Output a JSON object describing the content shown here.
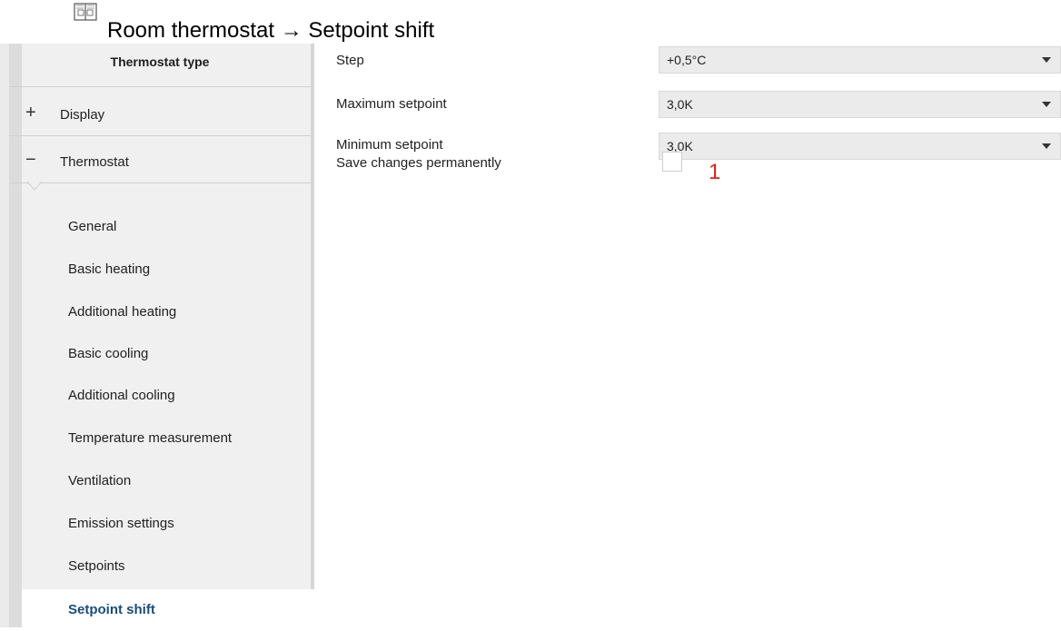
{
  "header": {
    "title": "Room thermostat → Setpoint shift",
    "icon": "book-icon"
  },
  "sidebar": {
    "section_title": "Thermostat type",
    "display": {
      "sign": "+",
      "label": "Display"
    },
    "thermostat": {
      "sign": "−",
      "label": "Thermostat"
    },
    "items": [
      {
        "label": "General"
      },
      {
        "label": "Basic heating"
      },
      {
        "label": "Additional heating"
      },
      {
        "label": "Basic cooling"
      },
      {
        "label": "Additional cooling"
      },
      {
        "label": "Temperature measurement"
      },
      {
        "label": "Ventilation"
      },
      {
        "label": "Emission settings"
      },
      {
        "label": "Setpoints"
      },
      {
        "label": "Setpoint shift",
        "active": true
      }
    ]
  },
  "main": {
    "step": {
      "label": "Step",
      "value": "+0,5°C"
    },
    "max_setpoint": {
      "label": "Maximum setpoint",
      "value": "3,0K"
    },
    "min_setpoint": {
      "label": "Minimum setpoint",
      "value": "3,0K"
    },
    "save_permanently": {
      "label": "Save changes permanently",
      "checked": false
    },
    "annotation_marker": "1"
  },
  "colors": {
    "active_item_text": "#1a4d7a",
    "marker": "#e02020",
    "sidebar_bg": "#f0f0f0",
    "select_bg": "#ebebeb"
  }
}
